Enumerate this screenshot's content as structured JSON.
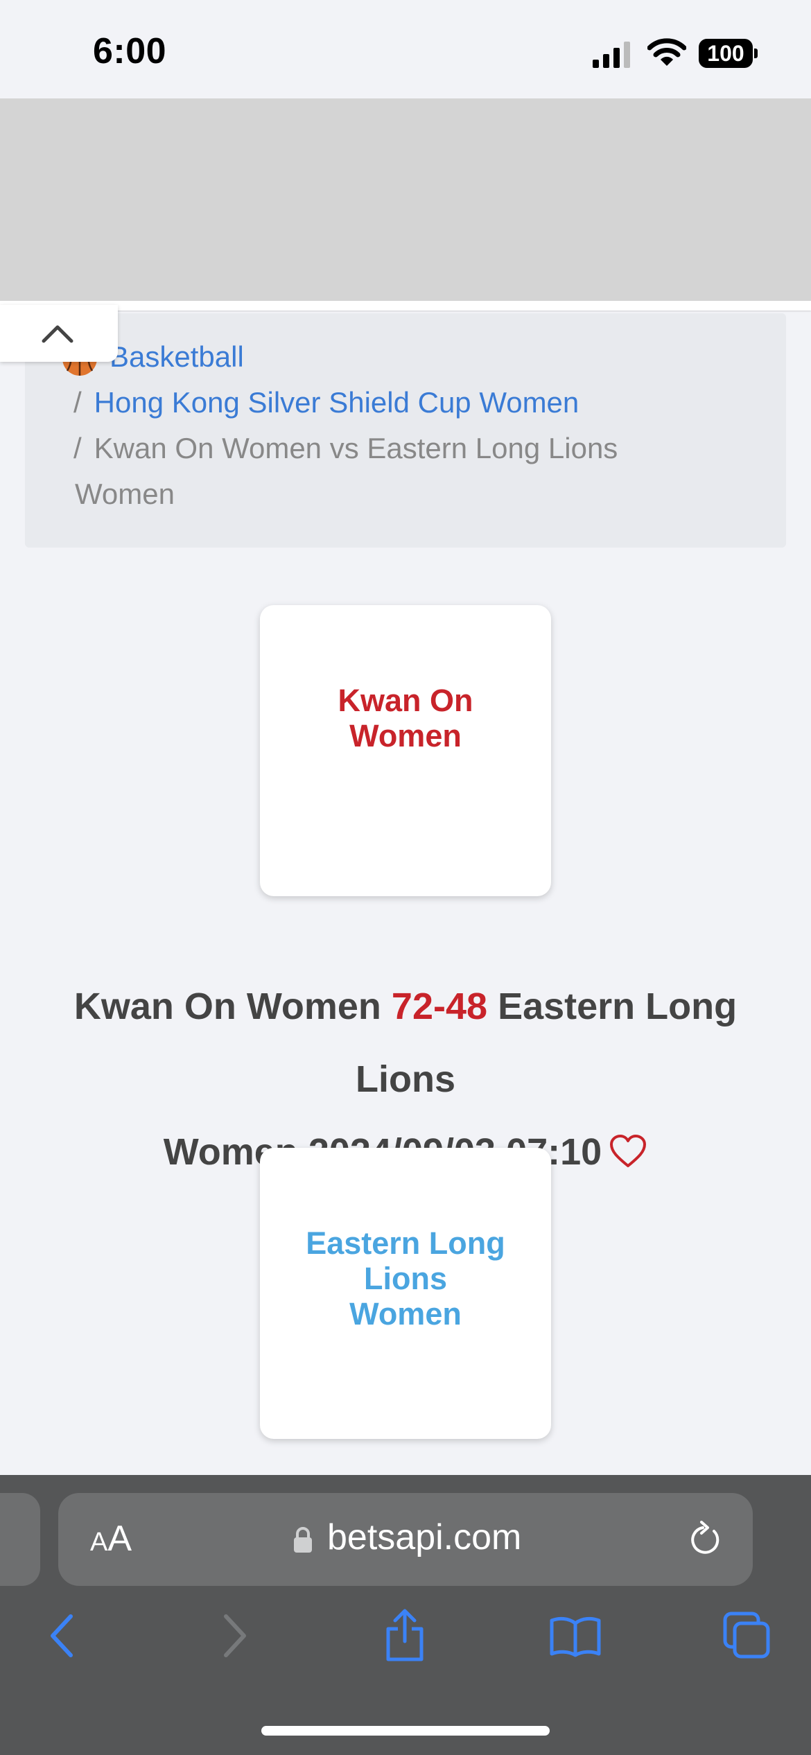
{
  "status_bar": {
    "time": "6:00",
    "battery": "100"
  },
  "breadcrumb": {
    "sport": "Basketball",
    "league": "Hong Kong Silver Shield Cup Women",
    "separator": "/",
    "current_line1": "Kwan On Women vs Eastern Long Lions",
    "current_line2": "Women"
  },
  "match": {
    "home_team_line1": "Kwan On",
    "home_team_line2": "Women",
    "away_team_line1": "Eastern Long",
    "away_team_line2": "Lions",
    "away_team_line3": "Women",
    "home_name": "Kwan On Women",
    "score": "72-48",
    "away_name_part1": "Eastern Long Lions",
    "away_name_part2": "Women",
    "datetime": "2024/09/03 07:10"
  },
  "browser": {
    "text_size_small": "A",
    "text_size_big": "A",
    "url": "betsapi.com"
  },
  "colors": {
    "link": "#3a7bd5",
    "home": "#c8232a",
    "away": "#4aa5e0",
    "browser_icons": "#3b82f6"
  },
  "icons": {
    "basketball": "basketball-icon",
    "favorite": "heart-icon",
    "collapse": "chevron-up-icon",
    "lock": "lock-icon",
    "reload": "reload-icon",
    "back": "back-icon",
    "forward": "forward-icon",
    "share": "share-icon",
    "bookmarks": "bookmarks-icon",
    "tabs": "tabs-icon"
  }
}
